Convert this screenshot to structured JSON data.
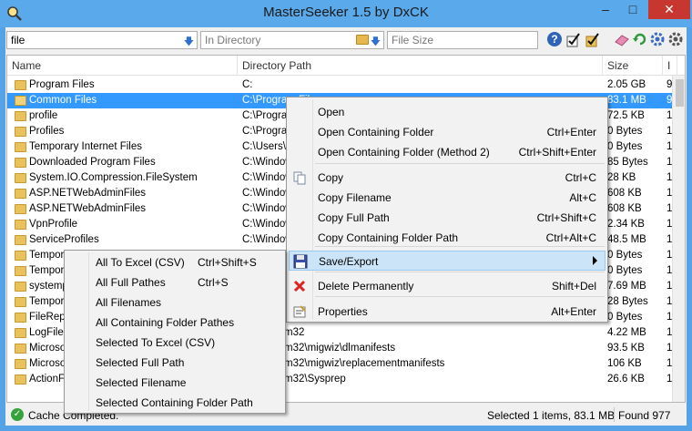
{
  "window": {
    "title": "MasterSeeker 1.5 by DxCK"
  },
  "toolbar": {
    "search_value": "file",
    "directory_placeholder": "In Directory",
    "size_placeholder": "File Size"
  },
  "columns": [
    "Name",
    "Directory Path",
    "Size",
    "I"
  ],
  "rows": [
    {
      "name": "Program Files",
      "dir": "C:",
      "size": "2.05 GB",
      "more": "9"
    },
    {
      "name": "Common Files",
      "dir": "C:\\Program Fil",
      "size": "83.1 MB",
      "more": "9"
    },
    {
      "name": "profile",
      "dir": "C:\\Program",
      "size": "72.5 KB",
      "more": "1"
    },
    {
      "name": "Profiles",
      "dir": "C:\\Program",
      "size": "0 Bytes",
      "more": "1"
    },
    {
      "name": "Temporary Internet Files",
      "dir": "C:\\Users\\",
      "size": "0 Bytes",
      "more": "1"
    },
    {
      "name": "Downloaded Program Files",
      "dir": "C:\\Window",
      "size": "85 Bytes",
      "more": "1"
    },
    {
      "name": "System.IO.Compression.FileSystem",
      "dir": "C:\\Window",
      "size": "28 KB",
      "more": "1"
    },
    {
      "name": "ASP.NETWebAdminFiles",
      "dir": "C:\\Window",
      "size": "608 KB",
      "more": "1"
    },
    {
      "name": "ASP.NETWebAdminFiles",
      "dir": "C:\\Window",
      "size": "608 KB",
      "more": "1"
    },
    {
      "name": "VpnProfile",
      "dir": "C:\\Window",
      "size": "2.34 KB",
      "more": "1"
    },
    {
      "name": "ServiceProfiles",
      "dir": "C:\\Window",
      "size": "48.5 MB",
      "more": "1"
    },
    {
      "name": "Tempor",
      "dir": "",
      "size": "0 Bytes",
      "more": "1"
    },
    {
      "name": "Tempor",
      "dir": "",
      "size": "0 Bytes",
      "more": "1"
    },
    {
      "name": "systemp",
      "dir": "",
      "size": "7.69 MB",
      "more": "1"
    },
    {
      "name": "Tempor",
      "dir": "",
      "size": "28 Bytes",
      "more": "1"
    },
    {
      "name": "FileRep",
      "dir": "",
      "size": "0 Bytes",
      "more": "1"
    },
    {
      "name": "LogFiles",
      "dir": "ws\\System32",
      "size": "4.22 MB",
      "more": "1"
    },
    {
      "name": "Microso",
      "dir": "ws\\System32\\migwiz\\dlmanifests",
      "size": "93.5 KB",
      "more": "1"
    },
    {
      "name": "Microso",
      "dir": "ws\\System32\\migwiz\\replacementmanifests",
      "size": "106 KB",
      "more": "1"
    },
    {
      "name": "ActionFi",
      "dir": "ws\\System32\\Sysprep",
      "size": "26.6 KB",
      "more": "1"
    }
  ],
  "context_menu": [
    {
      "label": "Open",
      "shortcut": ""
    },
    {
      "label": "Open Containing Folder",
      "shortcut": "Ctrl+Enter"
    },
    {
      "label": "Open Containing Folder (Method 2)",
      "shortcut": "Ctrl+Shift+Enter"
    },
    {
      "label": "Copy",
      "shortcut": "Ctrl+C"
    },
    {
      "label": "Copy Filename",
      "shortcut": "Alt+C"
    },
    {
      "label": "Copy Full Path",
      "shortcut": "Ctrl+Shift+C"
    },
    {
      "label": "Copy Containing Folder Path",
      "shortcut": "Ctrl+Alt+C"
    },
    {
      "label": "Save/Export",
      "shortcut": ""
    },
    {
      "label": "Delete Permanently",
      "shortcut": "Shift+Del"
    },
    {
      "label": "Properties",
      "shortcut": "Alt+Enter"
    }
  ],
  "submenu": [
    {
      "label": "All To Excel (CSV)",
      "shortcut": "Ctrl+Shift+S"
    },
    {
      "label": "All Full Pathes",
      "shortcut": "Ctrl+S"
    },
    {
      "label": "All Filenames",
      "shortcut": ""
    },
    {
      "label": "All Containing Folder Pathes",
      "shortcut": ""
    },
    {
      "label": "Selected To Excel (CSV)",
      "shortcut": ""
    },
    {
      "label": "Selected Full Path",
      "shortcut": ""
    },
    {
      "label": "Selected Filename",
      "shortcut": ""
    },
    {
      "label": "Selected Containing Folder Path",
      "shortcut": ""
    }
  ],
  "status": {
    "text": "Cache Completed.",
    "selection": "Selected 1 items, 83.1 MB",
    "found": "Found 977"
  }
}
